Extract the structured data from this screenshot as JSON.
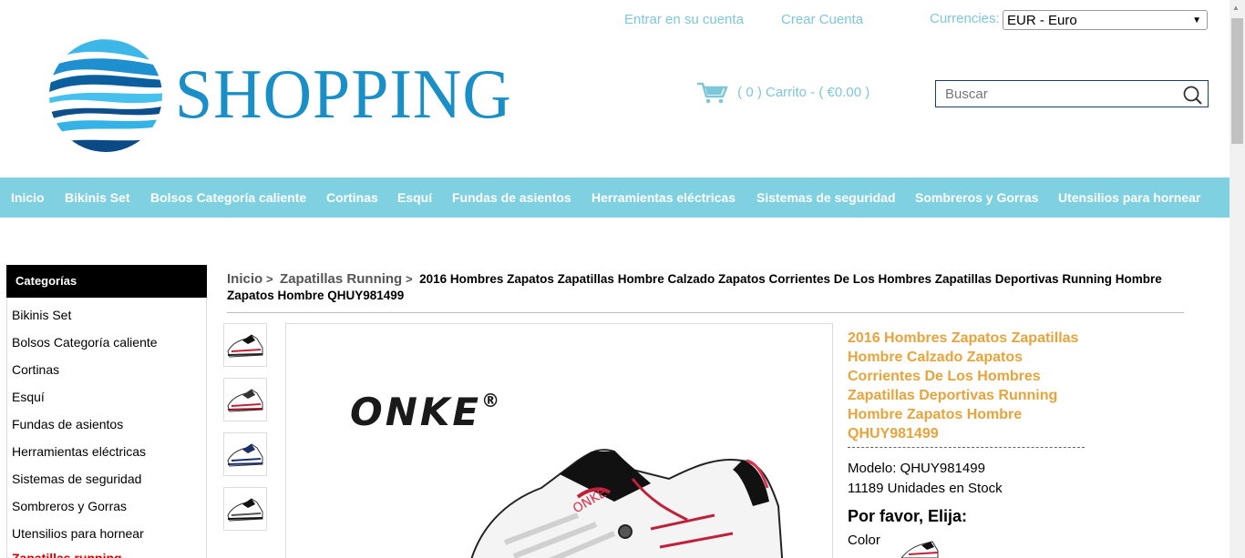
{
  "header": {
    "login_link": "Entrar en su cuenta",
    "register_link": "Crear Cuenta",
    "currency_label": "Currencies:",
    "currency_value": "EUR - Euro",
    "logo_text": "SHOPPING",
    "cart_text": "( 0 ) Carrito - ( €0.00 )",
    "search_placeholder": "Buscar"
  },
  "nav": {
    "items": [
      "Inicio",
      "Bikinis Set",
      "Bolsos Categoría caliente",
      "Cortinas",
      "Esquí",
      "Fundas de asientos",
      "Herramientas eléctricas",
      "Sistemas de seguridad",
      "Sombreros y Gorras",
      "Utensilios para hornear"
    ]
  },
  "sidebar": {
    "title": "Categorías",
    "items": [
      "Bikinis Set",
      "Bolsos Categoría caliente",
      "Cortinas",
      "Esquí",
      "Fundas de asientos",
      "Herramientas eléctricas",
      "Sistemas de seguridad",
      "Sombreros y Gorras",
      "Utensilios para hornear",
      "Zapatillas running"
    ]
  },
  "breadcrumb": {
    "home": "Inicio",
    "sep": ">",
    "category": "Zapatillas Running",
    "current": "2016 Hombres Zapatos Zapatillas Hombre Calzado Zapatos Corrientes De Los Hombres Zapatillas Deportivas Running Hombre Zapatos Hombre QHUY981499"
  },
  "product": {
    "brand": "ONKE",
    "title": "2016 Hombres Zapatos Zapatillas Hombre Calzado Zapatos Corrientes De Los Hombres Zapatillas Deportivas Running Hombre Zapatos Hombre QHUY981499",
    "model": "Modelo: QHUY981499",
    "stock": "11189 Unidades en Stock",
    "choose_prompt": "Por favor, Elija:",
    "color_label": "Color"
  },
  "colors": {
    "accent": "#7fd0e1",
    "brand_blue": "#1a8fc7",
    "title_orange": "#e8a33a"
  }
}
